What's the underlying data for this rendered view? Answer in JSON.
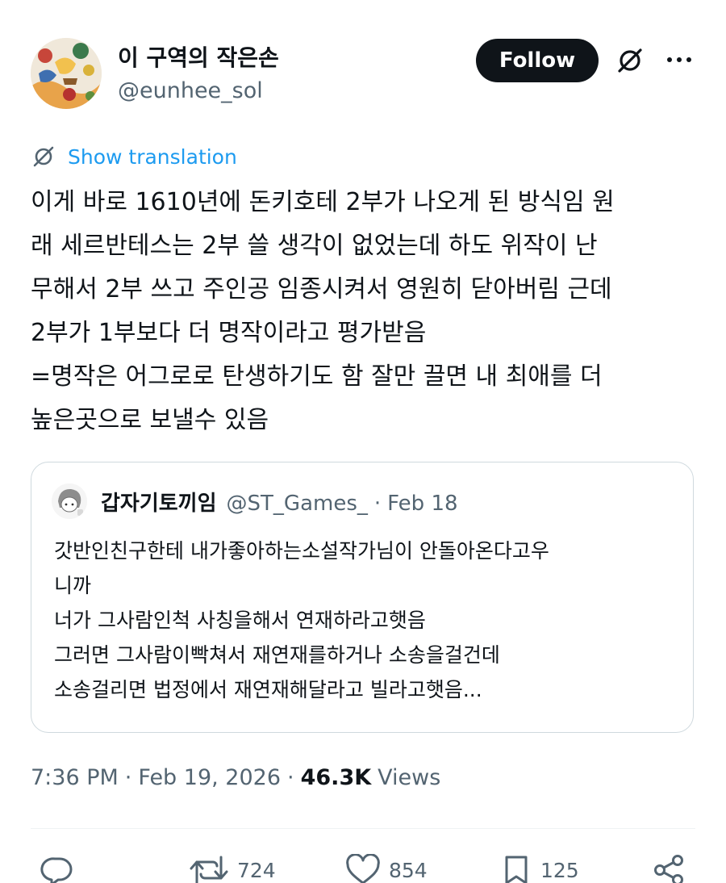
{
  "author": {
    "display_name": "이 구역의 작은손",
    "handle": "@eunhee_sol"
  },
  "actions_top": {
    "follow_label": "Follow",
    "grok_icon": "grok-icon",
    "more_icon": "more-icon"
  },
  "translation": {
    "label": "Show translation",
    "icon": "translate-icon"
  },
  "tweet": {
    "lines": [
      "이게 바로 1610년에 돈키호테 2부가 나오게 된 방식임 원",
      "래 세르반테스는 2부 쓸 생각이 없었는데 하도 위작이 난",
      "무해서 2부 쓰고 주인공 임종시켜서 영원히 닫아버림 근데",
      "2부가 1부보다 더 명작이라고 평가받음",
      "=명작은 어그로로 탄생하기도 함 잘만 끌면 내 최애를 더",
      "높은곳으로 보낼수 있음"
    ]
  },
  "quote": {
    "display_name": "갑자기토끼임",
    "handle": "@ST_Games_",
    "separator": "·",
    "date": "Feb 18",
    "lines": [
      "갓반인친구한테 내가좋아하는소설작가님이 안돌아온다고우",
      "니까",
      "너가 그사람인척 사칭을해서 연재하라고햇음",
      "그러면 그사람이빡쳐서 재연재를하거나 소송을걸건데",
      "소송걸리면 법정에서 재연재해달라고 빌라고햇음..."
    ]
  },
  "meta": {
    "time": "7:36 PM",
    "separator": "·",
    "date": "Feb 19, 2026",
    "views_count": "46.3K",
    "views_label": "Views"
  },
  "action_bar": {
    "reply_icon": "reply-icon",
    "retweet_count": "724",
    "like_count": "854",
    "bookmark_count": "125",
    "share_icon": "share-icon"
  },
  "colors": {
    "text_primary": "#0f1419",
    "text_secondary": "#536471",
    "link": "#1d9bf0",
    "follow_bg": "#0f1419",
    "border": "#cfd9de"
  }
}
